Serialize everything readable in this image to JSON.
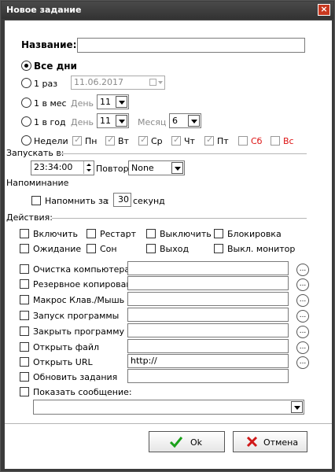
{
  "window": {
    "title": "Новое задание",
    "close_glyph": "×"
  },
  "name": {
    "label": "Название:",
    "value": ""
  },
  "schedule": {
    "all_days_label": "Все дни",
    "once_label": "1 раз",
    "once_date": "11.06.2017",
    "monthly_label": "1 в мес",
    "monthly_day_label": "День",
    "monthly_day_value": "11",
    "yearly_label": "1 в год",
    "yearly_day_label": "День",
    "yearly_day_value": "11",
    "yearly_month_label": "Месяц",
    "yearly_month_value": "6",
    "weeks_label": "Недели",
    "weekdays": [
      "Пн",
      "Вт",
      "Ср",
      "Чт",
      "Пт",
      "Сб",
      "Вс"
    ]
  },
  "start": {
    "label": "Запускать в:",
    "time": "23:34:00",
    "repeat_label": "Повтор:",
    "repeat_value": "None"
  },
  "reminder": {
    "section_label": "Напоминание",
    "remind_label": "Напомнить за",
    "colon": ":",
    "value": "30",
    "unit": "секунд"
  },
  "actions": {
    "section_label": "Действия:",
    "power": [
      "Включить",
      "Рестарт",
      "Выключить",
      "Блокировка",
      "Ожидание",
      "Сон",
      "Выход",
      "Выкл. монитор"
    ],
    "tasks": [
      "Очистка компьютера",
      "Резервное копирование",
      "Макрос Клав./Мышь",
      "Запуск программы",
      "Закрыть программу",
      "Открыть файл",
      "Открыть URL",
      "Обновить задания",
      "Показать сообщение:"
    ],
    "url_value": "http://",
    "browse_glyph": "..."
  },
  "buttons": {
    "ok_label": "Ok",
    "cancel_label": "Отмена",
    "ok_icon_color": "#1aa11a",
    "cancel_icon_color": "#d01818"
  }
}
